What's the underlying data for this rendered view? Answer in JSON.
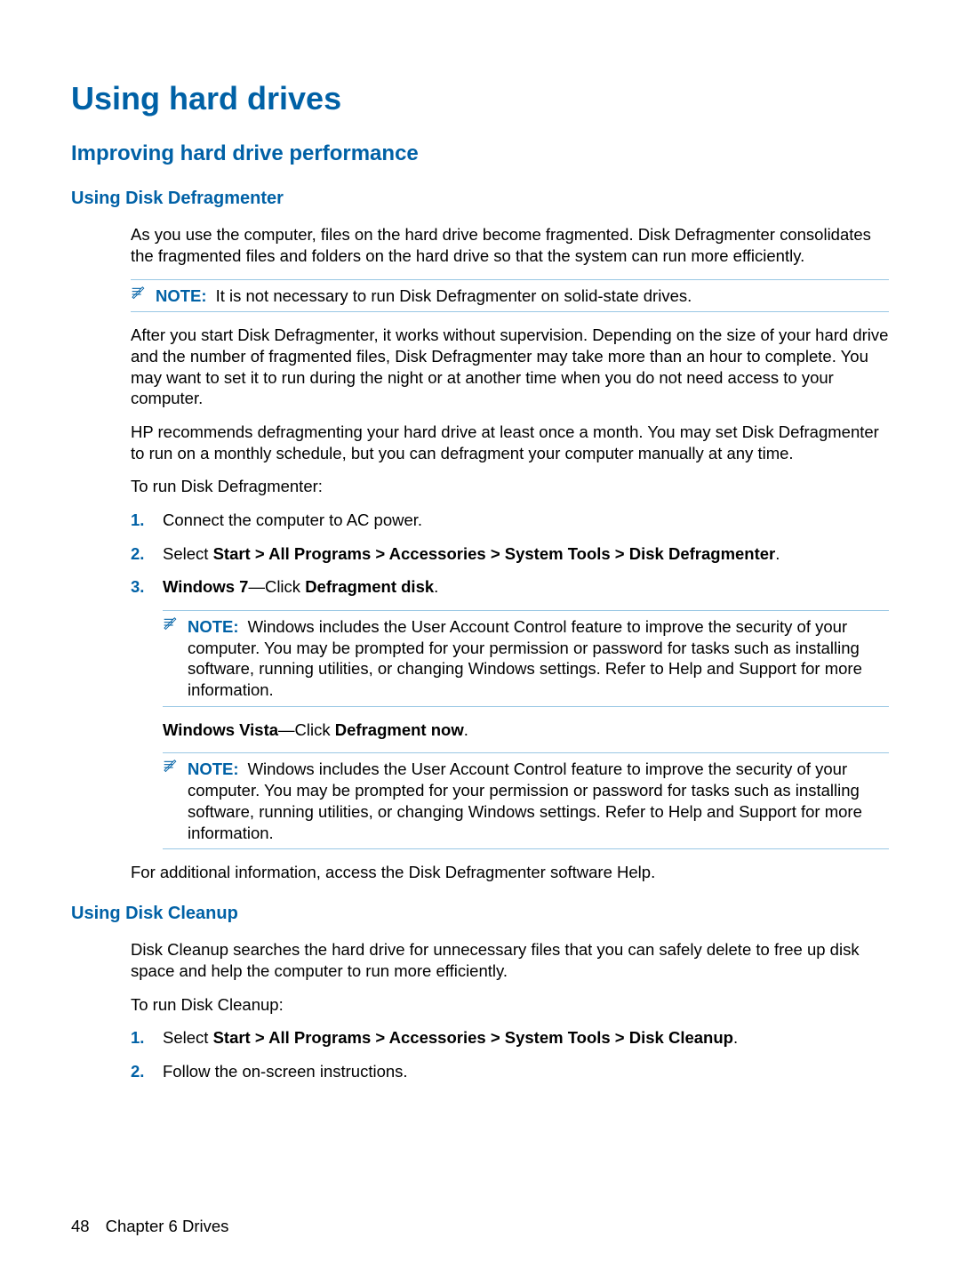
{
  "title": "Using hard drives",
  "section1": {
    "title": "Improving hard drive performance",
    "sub1": {
      "title": "Using Disk Defragmenter",
      "p1": "As you use the computer, files on the hard drive become fragmented. Disk Defragmenter consolidates the fragmented files and folders on the hard drive so that the system can run more efficiently.",
      "note1": {
        "label": "NOTE:",
        "text": "It is not necessary to run Disk Defragmenter on solid-state drives."
      },
      "p2": "After you start Disk Defragmenter, it works without supervision. Depending on the size of your hard drive and the number of fragmented files, Disk Defragmenter may take more than an hour to complete. You may want to set it to run during the night or at another time when you do not need access to your computer.",
      "p3": "HP recommends defragmenting your hard drive at least once a month. You may set Disk Defragmenter to run on a monthly schedule, but you can defragment your computer manually at any time.",
      "p4": "To run Disk Defragmenter:",
      "steps": {
        "s1": {
          "num": "1.",
          "text": "Connect the computer to AC power."
        },
        "s2": {
          "num": "2.",
          "prefix": "Select ",
          "bold": "Start > All Programs > Accessories > System Tools > Disk Defragmenter",
          "suffix": "."
        },
        "s3": {
          "num": "3.",
          "b1": "Windows 7",
          "mid1": "—Click ",
          "b2": "Defragment disk",
          "suffix": ".",
          "note2": {
            "label": "NOTE:",
            "text": "Windows includes the User Account Control feature to improve the security of your computer. You may be prompted for your permission or password for tasks such as installing software, running utilities, or changing Windows settings. Refer to Help and Support for more information."
          },
          "vb1": "Windows Vista",
          "vmid": "—Click ",
          "vb2": "Defragment now",
          "vsuffix": ".",
          "note3": {
            "label": "NOTE:",
            "text": "Windows includes the User Account Control feature to improve the security of your computer. You may be prompted for your permission or password for tasks such as installing software, running utilities, or changing Windows settings. Refer to Help and Support for more information."
          }
        }
      },
      "p5": "For additional information, access the Disk Defragmenter software Help."
    },
    "sub2": {
      "title": "Using Disk Cleanup",
      "p1": "Disk Cleanup searches the hard drive for unnecessary files that you can safely delete to free up disk space and help the computer to run more efficiently.",
      "p2": "To run Disk Cleanup:",
      "steps": {
        "s1": {
          "num": "1.",
          "prefix": "Select ",
          "bold": "Start > All Programs > Accessories > System Tools > Disk Cleanup",
          "suffix": "."
        },
        "s2": {
          "num": "2.",
          "text": "Follow the on-screen instructions."
        }
      }
    }
  },
  "footer": {
    "page": "48",
    "chapter": "Chapter 6   Drives"
  }
}
